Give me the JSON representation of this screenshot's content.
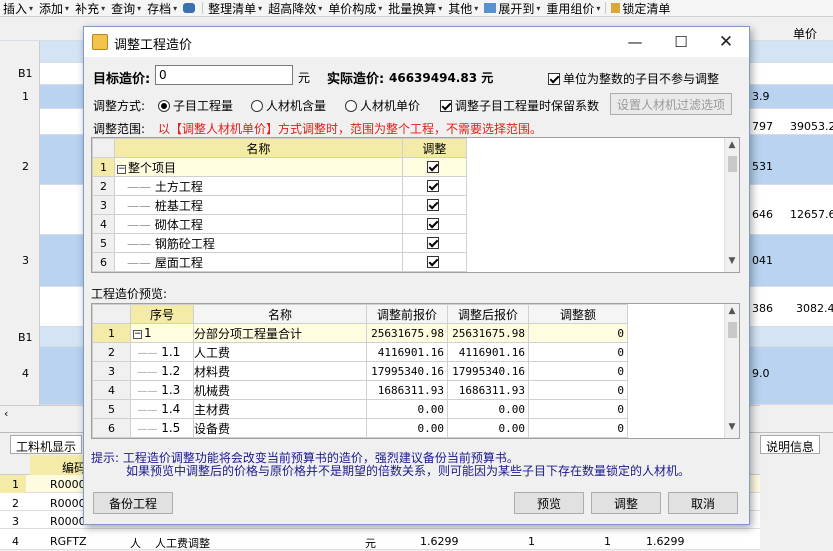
{
  "toolbar": {
    "items": [
      {
        "label": "插入"
      },
      {
        "label": "添加"
      },
      {
        "label": "补充"
      },
      {
        "label": "查询"
      },
      {
        "label": "存档"
      },
      {
        "label": "整理清单"
      },
      {
        "label": "超高降效"
      },
      {
        "label": "单价构成"
      },
      {
        "label": "批量换算"
      },
      {
        "label": "其他"
      },
      {
        "label": "展开到"
      },
      {
        "label": "重用组价"
      },
      {
        "label": "锁定清单"
      }
    ]
  },
  "background": {
    "header_right": "单价",
    "row_labels": [
      "B1",
      "1",
      "2",
      "3",
      "B1",
      "4"
    ],
    "row_values": [
      "3.9",
      "797",
      "39053.2",
      "531",
      "646",
      "12657.6",
      "041",
      "386",
      "3082.4",
      "9.0"
    ],
    "tab_left": "工料机显示",
    "tab_right": "说明信息",
    "bottom_header": "编码",
    "bottom_rows": [
      {
        "n": "1",
        "code": "R0000"
      },
      {
        "n": "2",
        "code": "R0000"
      },
      {
        "n": "3",
        "code": "R0000"
      },
      {
        "n": "4",
        "code": "RGFTZ",
        "type": "人",
        "name": "人工费调整",
        "unit": "元",
        "v1": "1.6299",
        "v2": "1",
        "v3": "1",
        "v4": "1.6299"
      }
    ]
  },
  "dialog": {
    "title": "调整工程造价",
    "target_label": "目标造价:",
    "target_value": "0",
    "unit": "元",
    "actual_label": "实际造价:",
    "actual_value": "46639494.83 元",
    "integer_skip_label": "单位为整数的子目不参与调整",
    "integer_skip_checked": true,
    "method_label": "调整方式:",
    "methods": [
      {
        "label": "子目工程量",
        "selected": true
      },
      {
        "label": "人材机含量",
        "selected": false
      },
      {
        "label": "人材机单价",
        "selected": false
      }
    ],
    "keep_coef_label": "调整子目工程量时保留系数",
    "keep_coef_checked": true,
    "filter_button": "设置人材机过滤选项",
    "range_label": "调整范围:",
    "range_note": "以【调整人材机单价】方式调整时，范围为整个工程，不需要选择范围。",
    "range_table": {
      "headers": [
        "名称",
        "调整"
      ],
      "rows": [
        {
          "n": "1",
          "name": "整个项目",
          "checked": true
        },
        {
          "n": "2",
          "name": "土方工程",
          "checked": true
        },
        {
          "n": "3",
          "name": "桩基工程",
          "checked": true
        },
        {
          "n": "4",
          "name": "砌体工程",
          "checked": true
        },
        {
          "n": "5",
          "name": "钢筋砼工程",
          "checked": true
        },
        {
          "n": "6",
          "name": "屋面工程",
          "checked": true
        }
      ]
    },
    "preview_label": "工程造价预览:",
    "preview_table": {
      "headers": [
        "序号",
        "名称",
        "调整前报价",
        "调整后报价",
        "调整额"
      ],
      "rows": [
        {
          "n": "1",
          "seq": "1",
          "name": "分部分项工程量合计",
          "before": "25631675.98",
          "after": "25631675.98",
          "diff": "0"
        },
        {
          "n": "2",
          "seq": "1.1",
          "name": "人工费",
          "before": "4116901.16",
          "after": "4116901.16",
          "diff": "0"
        },
        {
          "n": "3",
          "seq": "1.2",
          "name": "材料费",
          "before": "17995340.16",
          "after": "17995340.16",
          "diff": "0"
        },
        {
          "n": "4",
          "seq": "1.3",
          "name": "机械费",
          "before": "1686311.93",
          "after": "1686311.93",
          "diff": "0"
        },
        {
          "n": "5",
          "seq": "1.4",
          "name": "主材费",
          "before": "0.00",
          "after": "0.00",
          "diff": "0"
        },
        {
          "n": "6",
          "seq": "1.5",
          "name": "设备费",
          "before": "0.00",
          "after": "0.00",
          "diff": "0"
        }
      ]
    },
    "hint_line1": "提示: 工程造价调整功能将会改变当前预算书的造价，强烈建议备份当前预算书。",
    "hint_line2": "如果预览中调整后的价格与原价格并不是期望的倍数关系，则可能因为某些子目下存在数量锁定的人材机。",
    "buttons": {
      "backup": "备份工程",
      "preview": "预览",
      "adjust": "调整",
      "cancel": "取消"
    }
  }
}
